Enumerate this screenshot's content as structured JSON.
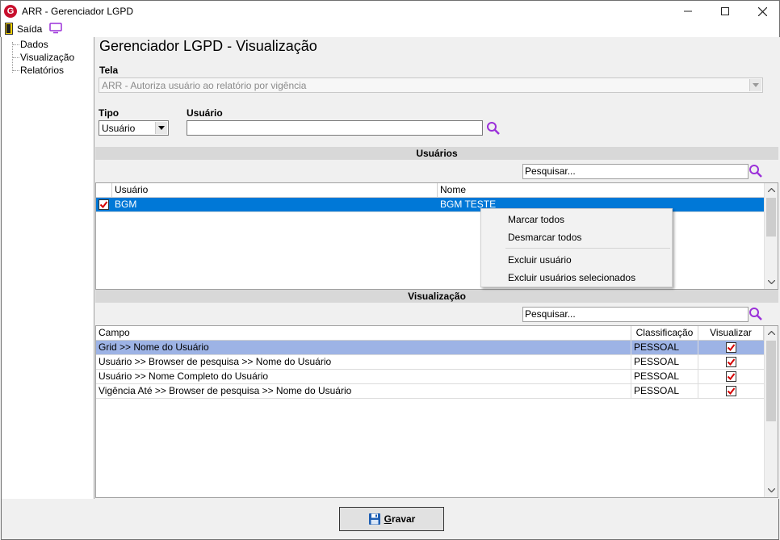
{
  "window": {
    "title": "ARR - Gerenciador LGPD",
    "logo_letter": "G"
  },
  "menubar": {
    "exit_label": "Saída"
  },
  "sidebar": {
    "items": [
      {
        "label": "Dados"
      },
      {
        "label": "Visualização"
      },
      {
        "label": "Relatórios"
      }
    ]
  },
  "main": {
    "page_title": "Gerenciador LGPD - Visualização",
    "tela": {
      "label": "Tela",
      "value": "ARR - Autoriza usuário ao relatório por vigência"
    },
    "tipo": {
      "label": "Tipo",
      "value": "Usuário"
    },
    "usuario": {
      "label": "Usuário",
      "value": ""
    }
  },
  "usuarios_section": {
    "header": "Usuários",
    "search_placeholder": "Pesquisar...",
    "columns": {
      "usuario": "Usuário",
      "nome": "Nome"
    },
    "rows": [
      {
        "checked": true,
        "usuario": "BGM",
        "nome": "BGM TESTE"
      }
    ]
  },
  "context_menu": {
    "items": [
      {
        "label": "Marcar todos"
      },
      {
        "label": "Desmarcar todos"
      },
      {
        "label": "Excluir usuário"
      },
      {
        "label": "Excluir usuários selecionados"
      }
    ]
  },
  "visualizacao_section": {
    "header": "Visualização",
    "search_placeholder": "Pesquisar...",
    "columns": {
      "campo": "Campo",
      "classificacao": "Classificação",
      "visualizar": "Visualizar"
    },
    "rows": [
      {
        "campo": "Grid >> Nome do Usuário",
        "classificacao": "PESSOAL",
        "visualizar": true
      },
      {
        "campo": "Usuário >> Browser de pesquisa >> Nome do Usuário",
        "classificacao": "PESSOAL",
        "visualizar": true
      },
      {
        "campo": "Usuário >> Nome Completo do Usuário",
        "classificacao": "PESSOAL",
        "visualizar": true
      },
      {
        "campo": "Vigência Até >> Browser de pesquisa >> Nome do Usuário",
        "classificacao": "PESSOAL",
        "visualizar": true
      }
    ]
  },
  "footer": {
    "save_label": "Gravar"
  },
  "colors": {
    "selection_blue": "#0078d7",
    "row_highlight": "#9db3e5",
    "check_red": "#d60000",
    "search_icon_purple": "#9b30d9"
  },
  "icons": {
    "app": "app-logo-icon",
    "exit": "door-exit-icon",
    "screen": "monitor-icon",
    "search": "magnifier-icon",
    "save": "floppy-disk-icon",
    "dropdown": "chevron-down-icon"
  }
}
